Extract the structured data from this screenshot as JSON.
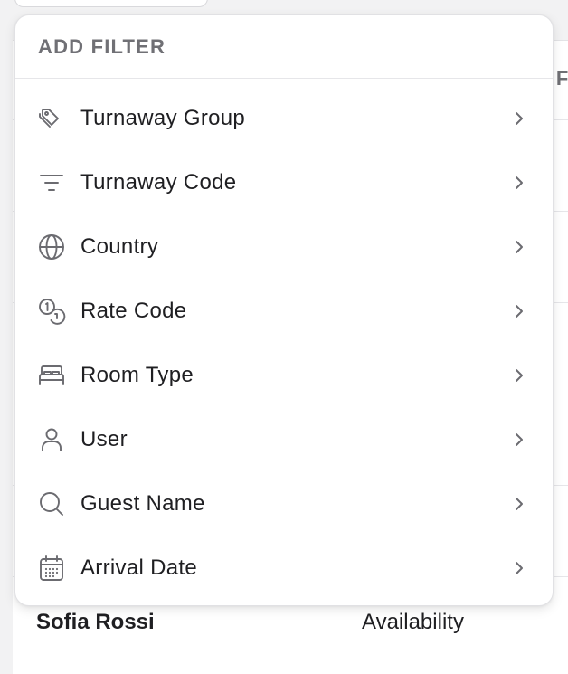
{
  "background": {
    "column_header_partial": "UF",
    "row_name_partial": "Sofia Rossi",
    "row_value_partial": "Availability"
  },
  "dropdown": {
    "title": "ADD FILTER",
    "items": [
      {
        "label": "Turnaway Group",
        "icon": "tag-icon"
      },
      {
        "label": "Turnaway Code",
        "icon": "filter-lines-icon"
      },
      {
        "label": "Country",
        "icon": "globe-icon"
      },
      {
        "label": "Rate Code",
        "icon": "coins-icon"
      },
      {
        "label": "Room Type",
        "icon": "bed-icon"
      },
      {
        "label": "User",
        "icon": "user-icon"
      },
      {
        "label": "Guest Name",
        "icon": "search-icon"
      },
      {
        "label": "Arrival Date",
        "icon": "calendar-icon"
      }
    ]
  },
  "colors": {
    "icon": "#6b6b70",
    "text": "#1f1f22",
    "header_text": "#707075",
    "divider": "#e6e6e9"
  }
}
